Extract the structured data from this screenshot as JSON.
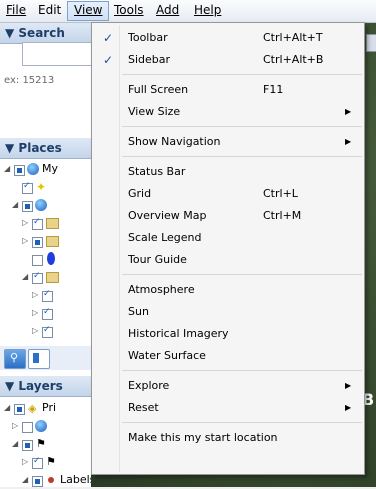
{
  "menubar": {
    "items": [
      "File",
      "Edit",
      "View",
      "Tools",
      "Add",
      "Help"
    ],
    "active": "View"
  },
  "left_panel": {
    "search": {
      "header": "▼ Search",
      "hint": "ex: 15213"
    },
    "places": {
      "header": "▼ Places",
      "rows": [
        "My"
      ]
    },
    "layers": {
      "header": "▼ Layers",
      "rows": [
        "Pri",
        "Labels"
      ]
    }
  },
  "map": {
    "overlay_text": "B"
  },
  "view_menu": {
    "items": [
      {
        "label": "Toolbar",
        "shortcut": "Ctrl+Alt+T",
        "checked": true
      },
      {
        "label": "Sidebar",
        "shortcut": "Ctrl+Alt+B",
        "checked": true
      },
      {
        "label": "Full Screen",
        "shortcut": "F11"
      },
      {
        "label": "View Size",
        "submenu": true
      },
      {
        "label": "Show Navigation",
        "submenu": true
      },
      {
        "label": "Status Bar"
      },
      {
        "label": "Grid",
        "shortcut": "Ctrl+L"
      },
      {
        "label": "Overview Map",
        "shortcut": "Ctrl+M"
      },
      {
        "label": "Scale Legend"
      },
      {
        "label": "Tour Guide"
      },
      {
        "label": "Atmosphere"
      },
      {
        "label": "Sun"
      },
      {
        "label": "Historical Imagery"
      },
      {
        "label": "Water Surface"
      },
      {
        "label": "Explore",
        "submenu": true
      },
      {
        "label": "Reset",
        "submenu": true
      },
      {
        "label": "Make this my start location"
      }
    ],
    "check_glyph": "✓",
    "arrow_glyph": "▶"
  }
}
